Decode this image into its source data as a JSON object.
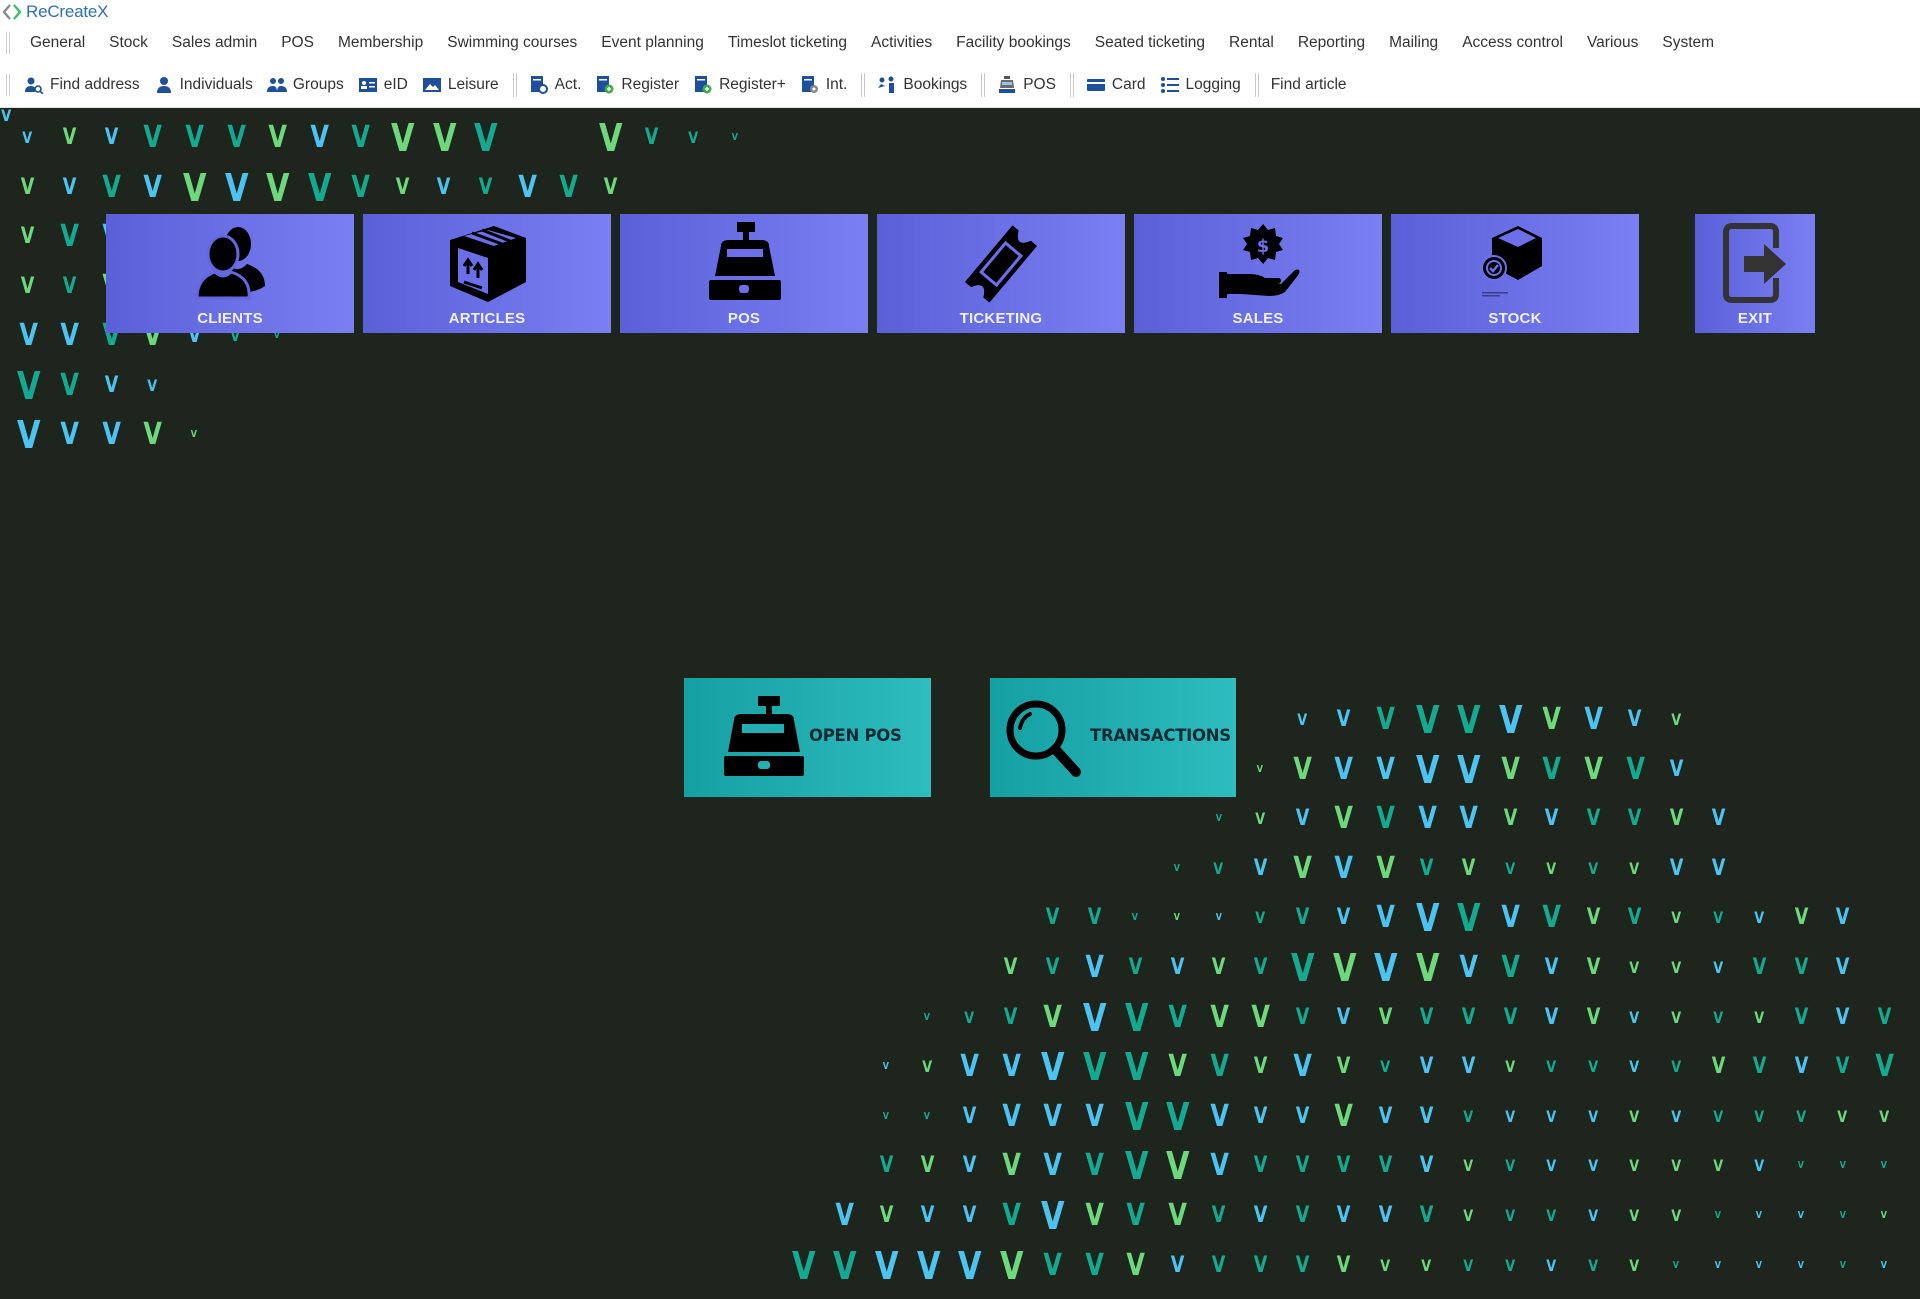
{
  "app": {
    "title": "ReCreateX",
    "brand_color": "#2f6fb6",
    "logo_icon": "diamond-chevron-icon"
  },
  "menu": [
    "General",
    "Stock",
    "Sales admin",
    "POS",
    "Membership",
    "Swimming courses",
    "Event planning",
    "Timeslot ticketing",
    "Activities",
    "Facility bookings",
    "Seated ticketing",
    "Rental",
    "Reporting",
    "Mailing",
    "Access control",
    "Various",
    "System"
  ],
  "toolbar": {
    "groups": [
      [
        {
          "label": "Find address",
          "icon": "find-address-icon"
        },
        {
          "label": "Individuals",
          "icon": "person-icon"
        },
        {
          "label": "Groups",
          "icon": "group-icon"
        },
        {
          "label": "eID",
          "icon": "id-card-icon"
        },
        {
          "label": "Leisure",
          "icon": "image-icon"
        }
      ],
      [
        {
          "label": "Act.",
          "icon": "doc-gear-icon"
        },
        {
          "label": "Register",
          "icon": "doc-add-icon"
        },
        {
          "label": "Register+",
          "icon": "doc-add-plus-icon"
        },
        {
          "label": "Int.",
          "icon": "doc-settings-icon"
        }
      ],
      [
        {
          "label": "Bookings",
          "icon": "bookings-icon"
        }
      ],
      [
        {
          "label": "POS",
          "icon": "cash-register-icon"
        }
      ],
      [
        {
          "label": "Card",
          "icon": "card-icon"
        },
        {
          "label": "Logging",
          "icon": "list-icon"
        }
      ],
      [
        {
          "label": "Find article",
          "icon": null
        }
      ]
    ]
  },
  "tiles": [
    {
      "label": "CLIENTS",
      "icon": "clients-icon"
    },
    {
      "label": "ARTICLES",
      "icon": "box-icon"
    },
    {
      "label": "POS",
      "icon": "cash-register-icon"
    },
    {
      "label": "TICKETING",
      "icon": "ticket-icon"
    },
    {
      "label": "SALES",
      "icon": "hand-dollar-icon"
    },
    {
      "label": "STOCK",
      "icon": "stock-box-check-icon"
    },
    {
      "label": "EXIT",
      "icon": "exit-icon"
    }
  ],
  "actions": [
    {
      "label": "OPEN POS",
      "icon": "cash-register-icon"
    },
    {
      "label": "TRANSACTIONS",
      "icon": "magnifier-icon"
    }
  ],
  "colors": {
    "tile_start": "#5a60d8",
    "tile_end": "#7a7ff2",
    "action_start": "#15a0a4",
    "action_end": "#2ebcbd",
    "background": "#1d251d",
    "pattern": {
      "b": "#4cc3f0",
      "g": "#6ed97c",
      "t": "#14a991"
    }
  },
  "pattern": {
    "top_left": [
      "1b 2g 2b 3t 3t 3t 3g 3b 3t 4g 4g 4t 5t 5b 4g 2t 1t 0t",
      "2g 2b 3t 3b 4g 4b 4g 4t 3t 2g 2b 2t 3b 3t 2g",
      "2g 3t 3b",
      "2g 2t 3g",
      "3b 3b 3t 3g 2b 1t 0t",
      "4t 3t 2b 1b",
      "4b 3b 3b 3g 0g"
    ],
    "bottom_right": [
      "............1b 2b 3t 4t 4t 4b 3g 3b 2b 1g",
      "...........0g 3g 3b 3b 4b 4b 3g 3t 3g 3t 2b",
      "..........0t 1g 2b 3g 3t 3b 3b 2g 2b 2t 2t 2g 2b",
      ".........0t 1t 2b 3g 3b 3g 2t 2g 1t 1g 1t 1g 2b 2b",
      "......2t 2t 0t 0g 0b 1t 2t 2b 3b 4b 4t 3b 3t 2g 2t 1g 1t 1b 2g 2b",
      ".....2g 2t 3b 2t 2b 2g 2t 4t 4g 4b 4g 3b 3t 2b 2g 1g 1g 1b 2t 2t 2b",
      "...0t 1t 2t 3g 4b 4t 3t 3g 3g 2t 2b 2g 2t 2t 2t 2b 2g 1b 1g 1t 1g 2t 2b 2t",
      "..0b 1g 3b 3b 4b 4t 4t 3g 3t 2g 3b 2g 1t 2b 2b 1g 1t 1t 1b 1t 2g 2t 2b 2t 3t",
      "..0t 0t 2b 3b 3b 3b 4t 4t 3b 2b 2b 3g 2b 2b 1t 1b 1b 1b 1g 1b 1t 1t 1t 1g 1g 1b",
      "..2t 2g 2b 3g 3b 3t 4t 4g 3b 2t 2t 2t 2t 2b 1g 1t 1b 1b 1g 1g 1g 1b 0t 0t 0t 0t",
      ".3b 2g 2b 2b 3t 4b 3g 3t 3g 2t 2b 2t 2b 2b 2t 1g 1t 1t 1b 1g 1g 0t 0b 0b 0t 0g 0t",
      "4t 4t 4b 4b 4b 4g 3t 3t 3g 2b 2t 2t 2t 2g 1g 1g 1t 1t 1b 1t 1g 0t 0b 0b 0b 0t 0b"
    ]
  }
}
